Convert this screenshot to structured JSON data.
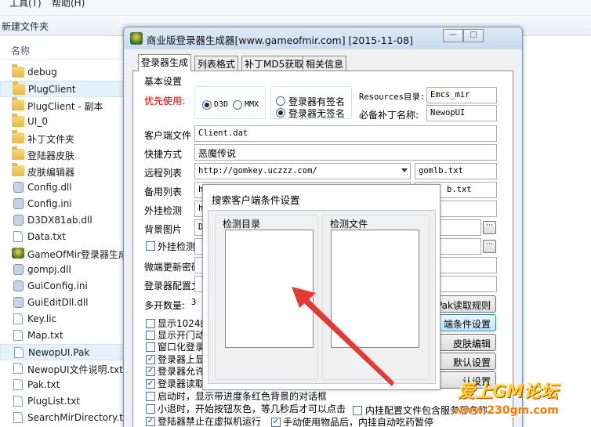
{
  "explorer": {
    "menu": [
      "工具(T)",
      "帮助(H)"
    ],
    "command": "新建文件夹",
    "column_name": "名称",
    "items": [
      {
        "name": "debug",
        "icon": "folder-icon"
      },
      {
        "name": "PlugClient",
        "icon": "folder-icon",
        "selected": true
      },
      {
        "name": "PlugClient - 副本",
        "icon": "folder-icon"
      },
      {
        "name": "UI_0",
        "icon": "folder-icon"
      },
      {
        "name": "补丁文件夹",
        "icon": "folder-icon"
      },
      {
        "name": "登陆器皮肤",
        "icon": "folder-icon"
      },
      {
        "name": "皮肤编辑器",
        "icon": "folder-icon"
      },
      {
        "name": "Config.dll",
        "icon": "gear-icon"
      },
      {
        "name": "Config.ini",
        "icon": "gear-icon"
      },
      {
        "name": "D3DX81ab.dll",
        "icon": "gear-icon"
      },
      {
        "name": "Data.txt",
        "icon": "document-icon"
      },
      {
        "name": "GameOfMir登录器生成",
        "icon": "app-icon"
      },
      {
        "name": "gompj.dll",
        "icon": "gear-icon"
      },
      {
        "name": "GuiConfig.ini",
        "icon": "gear-icon"
      },
      {
        "name": "GuiEditDll.dll",
        "icon": "gear-icon"
      },
      {
        "name": "Key.lic",
        "icon": "document-icon"
      },
      {
        "name": "Map.txt",
        "icon": "document-icon"
      },
      {
        "name": "NewopUI.Pak",
        "icon": "document-icon",
        "selected": true
      },
      {
        "name": "NewopUI文件说明.txt",
        "icon": "document-icon"
      },
      {
        "name": "Pak.txt",
        "icon": "document-icon"
      },
      {
        "name": "PlugList.txt",
        "icon": "document-icon"
      },
      {
        "name": "SearchMirDirectory.tx",
        "icon": "document-icon"
      }
    ]
  },
  "dialog": {
    "title": "商业版登录器生成器[www.gameofmir.com] [2015-11-08]",
    "tabs": [
      "登录器生成",
      "列表格式",
      "补丁MD5获取",
      "相关信息"
    ],
    "basic_settings": "基本设置",
    "priority_label": "优先使用:",
    "d3d": "D3D",
    "mmx": "MMX",
    "sign_with": "登录器有签名",
    "sign_without": "登录器无签名",
    "resources_dir_label": "Resources目录:",
    "resources_dir_value": "Emcs_mir",
    "patch_name_label": "必备补丁名称:",
    "patch_name_value": "NewopUI",
    "client_file_label": "客户端文件",
    "client_file_value": "Client.dat",
    "shortcut_label": "快捷方式",
    "shortcut_value": "恶魔传说",
    "remote_list_label": "远程列表",
    "remote_list_value": "http://gomkey.uczzz.com/",
    "remote_list_file": "gomlb.txt",
    "backup_list_label": "备用列表",
    "backup_list_value": "ht",
    "backup_list_file": "b.txt",
    "plugin_check_label": "外挂检测",
    "plugin_check_value": "ht",
    "bg_image_label": "背景图片",
    "bg_image_value": "D:",
    "plugin_list_label": "外挂检测列",
    "micro_update_label": "微端更新密码",
    "launcher_config_label": "登录器配置文件",
    "multi_open_label": "多开数量:",
    "multi_open_value": "3",
    "btn_pak": "Pak读取规则",
    "btn_search": "端条件设置",
    "btn_skin": "皮肤编辑",
    "btn_default": "默认设置",
    "btn_recognize": "认设置",
    "options": [
      {
        "label": "显示1024的",
        "checked": false
      },
      {
        "label": "显示开门动",
        "checked": false
      },
      {
        "label": "窗口化登录",
        "checked": false
      },
      {
        "label": "登录器上显",
        "checked": true
      },
      {
        "label": "登录器允许",
        "checked": true
      },
      {
        "label": "登录器读取",
        "checked": true
      },
      {
        "label": "启动时，显示带进度条红色背景的对话框",
        "checked": false
      },
      {
        "label": "小退时，开始按钮灰色，等几秒后才可以点击",
        "checked": false
      },
      {
        "label": "登陆器禁止在虚拟机运行",
        "checked": true
      }
    ],
    "option_inner_config": "内挂配置文件包含服务器名称",
    "option_manual_use": "手动使用物品后，内挂自动吃药暂停"
  },
  "popup": {
    "title": "搜索客户端条件设置",
    "check_dir": "检测目录",
    "check_file": "检测文件"
  },
  "watermark": {
    "line1": "爱上GM论坛",
    "line2": "www.230gm.com"
  },
  "colors": {
    "arrow": "#e53935",
    "window_border": "#7f94b3",
    "selection": "#e5f1fb"
  }
}
